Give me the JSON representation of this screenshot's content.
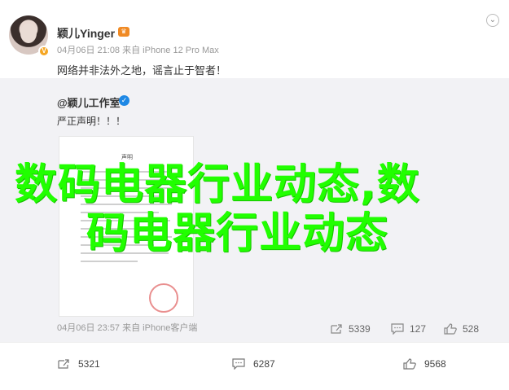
{
  "post": {
    "username": "颖儿Yinger",
    "meta": "04月06日 21:08 来自 iPhone 12 Pro Max",
    "text": "网络并非法外之地，谣言止于智者！"
  },
  "repost": {
    "username": "@颖儿工作室",
    "text": "严正声明！！！",
    "doc_title": "声明",
    "meta": "04月06日 23:57 来自 iPhone客户端",
    "stats": {
      "shares": "5339",
      "comments": "127",
      "likes": "528"
    }
  },
  "overlay": {
    "line1": "数码电器行业动态,数",
    "line2": "码电器行业动态"
  },
  "footer": {
    "shares": "5321",
    "comments": "6287",
    "likes": "9568"
  },
  "icons": {
    "share": "share-icon",
    "comment": "comment-icon",
    "like": "thumbs-up-icon",
    "menu": "chevron-down-icon",
    "verified": "verified-badge-icon",
    "vip": "vip-crown-icon"
  },
  "colors": {
    "overlay_text": "#21ff00",
    "repost_bg": "#f2f2f5",
    "verified_blue": "#1e88e5"
  }
}
